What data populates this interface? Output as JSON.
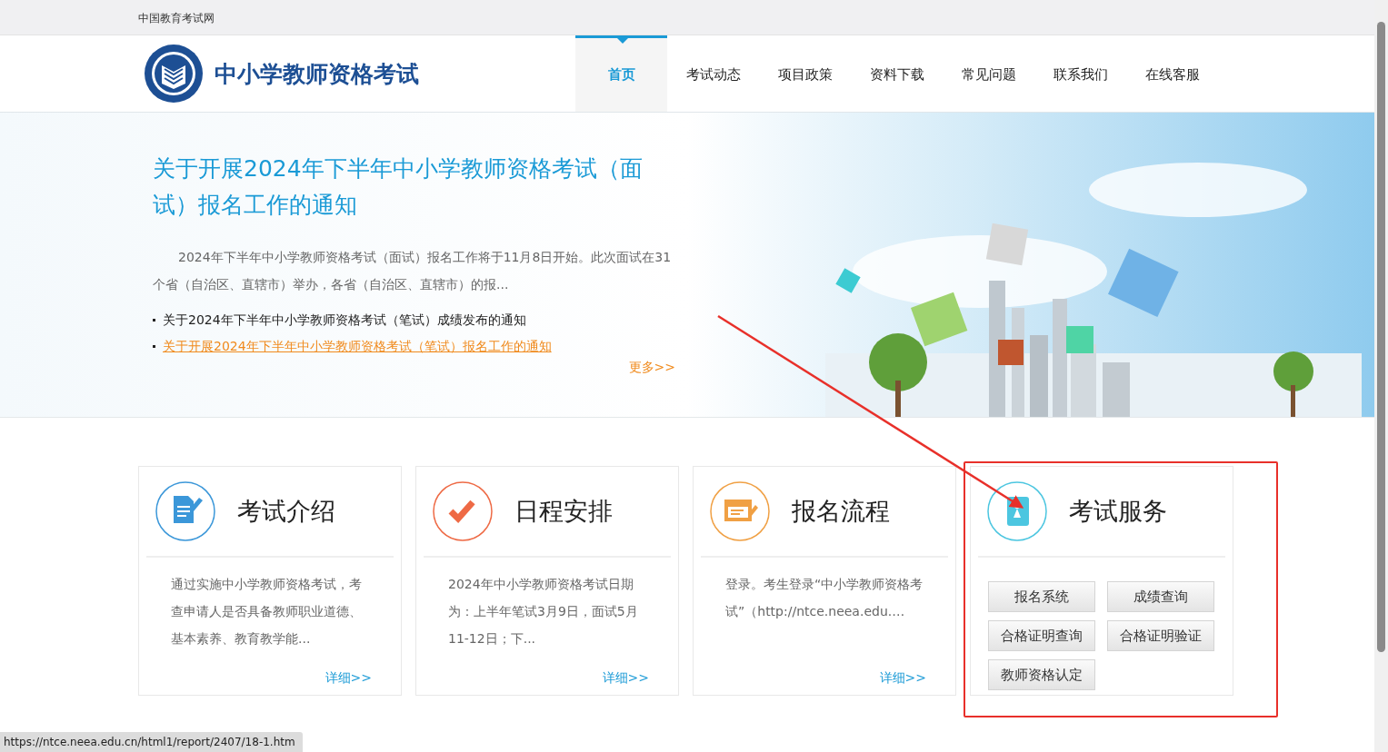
{
  "top_bar": {
    "site_name": "中国教育考试网"
  },
  "header": {
    "logo_title": "中小学教师资格考试",
    "nav": [
      {
        "label": "首页",
        "selected": true
      },
      {
        "label": "考试动态",
        "selected": false
      },
      {
        "label": "项目政策",
        "selected": false
      },
      {
        "label": "资料下载",
        "selected": false
      },
      {
        "label": "常见问题",
        "selected": false
      },
      {
        "label": "联系我们",
        "selected": false
      },
      {
        "label": "在线客服",
        "selected": false
      }
    ]
  },
  "hero": {
    "title": "关于开展2024年下半年中小学教师资格考试（面试）报名工作的通知",
    "summary": "2024年下半年中小学教师资格考试（面试）报名工作将于11月8日开始。此次面试在31个省（自治区、直辖市）举办，各省（自治区、直辖市）的报...",
    "news": [
      {
        "text": "关于2024年下半年中小学教师资格考试（笔试）成绩发布的通知",
        "hovered": false
      },
      {
        "text": "关于开展2024年下半年中小学教师资格考试（笔试）报名工作的通知",
        "hovered": true
      }
    ],
    "more": "更多>>"
  },
  "cards": [
    {
      "kind": "text",
      "color": "#3b97d9",
      "title": "考试介绍",
      "description": "通过实施中小学教师资格考试，考查申请人是否具备教师职业道德、基本素养、教育教学能...",
      "link": "详细>>"
    },
    {
      "kind": "text",
      "color": "#ee6a45",
      "title": "日程安排",
      "description": "2024年中小学教师资格考试日期为：上半年笔试3月9日，面试5月11-12日；下...",
      "link": "详细>>"
    },
    {
      "kind": "text",
      "color": "#f0a044",
      "title": "报名流程",
      "description": "登录。考生登录“中小学教师资格考试”（http://ntce.neea.edu.…",
      "link": "详细>>"
    },
    {
      "kind": "buttons",
      "color": "#4cc6e0",
      "title": "考试服务",
      "buttons": [
        "报名系统",
        "成绩查询",
        "合格证明查询",
        "合格证明验证",
        "教师资格认定"
      ]
    }
  ],
  "status_bar": {
    "url": "https://ntce.neea.edu.cn/html1/report/2407/18-1.htm"
  }
}
